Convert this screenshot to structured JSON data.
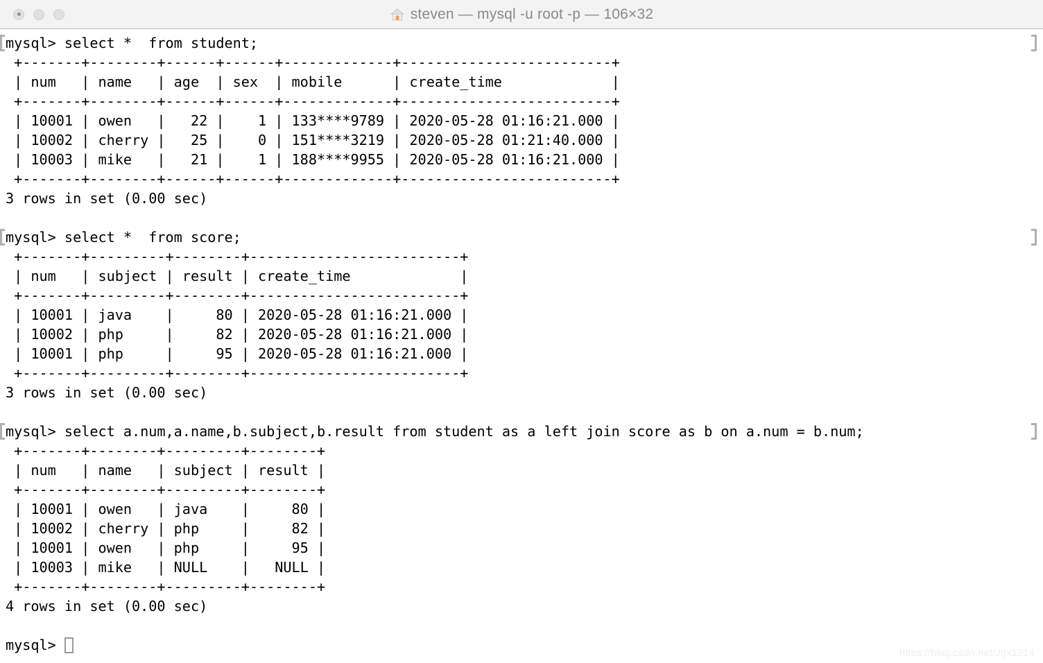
{
  "window": {
    "title": "steven — mysql -u root -p — 106×32",
    "title_icon": "house-icon",
    "traffic_lights": [
      {
        "name": "close-button",
        "label": ""
      },
      {
        "name": "minimize-button",
        "label": ""
      },
      {
        "name": "zoom-button",
        "label": ""
      }
    ],
    "colors": {
      "titlebar_bg": "#f3f3f3",
      "titlebar_border": "#b5b5b5",
      "terminal_bg": "#ffffff",
      "terminal_fg": "#000000",
      "title_fg": "#8a8a8a",
      "mark_color": "#b0b0b0",
      "cursor_border": "#9a9a9a",
      "watermark_fg": "#f1f1f1"
    }
  },
  "terminal": {
    "prompt": "mysql> ",
    "cursor": "block-hollow",
    "lines": [
      {
        "mark": true,
        "text": "mysql> select *  from student;"
      },
      {
        "mark": false,
        "text": " +-------+--------+------+------+-------------+-------------------------+"
      },
      {
        "mark": false,
        "text": " | num   | name   | age  | sex  | mobile      | create_time             |"
      },
      {
        "mark": false,
        "text": " +-------+--------+------+------+-------------+-------------------------+"
      },
      {
        "mark": false,
        "text": " | 10001 | owen   |   22 |    1 | 133****9789 | 2020-05-28 01:16:21.000 |"
      },
      {
        "mark": false,
        "text": " | 10002 | cherry |   25 |    0 | 151****3219 | 2020-05-28 01:21:40.000 |"
      },
      {
        "mark": false,
        "text": " | 10003 | mike   |   21 |    1 | 188****9955 | 2020-05-28 01:16:21.000 |"
      },
      {
        "mark": false,
        "text": " +-------+--------+------+------+-------------+-------------------------+"
      },
      {
        "mark": false,
        "text": "3 rows in set (0.00 sec)"
      },
      {
        "mark": false,
        "text": ""
      },
      {
        "mark": true,
        "text": "mysql> select *  from score;"
      },
      {
        "mark": false,
        "text": " +-------+---------+--------+-------------------------+"
      },
      {
        "mark": false,
        "text": " | num   | subject | result | create_time             |"
      },
      {
        "mark": false,
        "text": " +-------+---------+--------+-------------------------+"
      },
      {
        "mark": false,
        "text": " | 10001 | java    |     80 | 2020-05-28 01:16:21.000 |"
      },
      {
        "mark": false,
        "text": " | 10002 | php     |     82 | 2020-05-28 01:16:21.000 |"
      },
      {
        "mark": false,
        "text": " | 10001 | php     |     95 | 2020-05-28 01:16:21.000 |"
      },
      {
        "mark": false,
        "text": " +-------+---------+--------+-------------------------+"
      },
      {
        "mark": false,
        "text": "3 rows in set (0.00 sec)"
      },
      {
        "mark": false,
        "text": ""
      },
      {
        "mark": true,
        "text": "mysql> select a.num,a.name,b.subject,b.result from student as a left join score as b on a.num = b.num;"
      },
      {
        "mark": false,
        "text": " +-------+--------+---------+--------+"
      },
      {
        "mark": false,
        "text": " | num   | name   | subject | result |"
      },
      {
        "mark": false,
        "text": " +-------+--------+---------+--------+"
      },
      {
        "mark": false,
        "text": " | 10001 | owen   | java    |     80 |"
      },
      {
        "mark": false,
        "text": " | 10002 | cherry | php     |     82 |"
      },
      {
        "mark": false,
        "text": " | 10001 | owen   | php     |     95 |"
      },
      {
        "mark": false,
        "text": " | 10003 | mike   | NULL    |   NULL |"
      },
      {
        "mark": false,
        "text": " +-------+--------+---------+--------+"
      },
      {
        "mark": false,
        "text": "4 rows in set (0.00 sec)"
      },
      {
        "mark": false,
        "text": ""
      }
    ],
    "final_prompt": "mysql> "
  },
  "queries": [
    {
      "command": "select *  from student;",
      "result_table": {
        "columns": [
          "num",
          "name",
          "age",
          "sex",
          "mobile",
          "create_time"
        ],
        "rows": [
          [
            "10001",
            "owen",
            "22",
            "1",
            "133****9789",
            "2020-05-28 01:16:21.000"
          ],
          [
            "10002",
            "cherry",
            "25",
            "0",
            "151****3219",
            "2020-05-28 01:21:40.000"
          ],
          [
            "10003",
            "mike",
            "21",
            "1",
            "188****9955",
            "2020-05-28 01:16:21.000"
          ]
        ]
      },
      "status": "3 rows in set (0.00 sec)"
    },
    {
      "command": "select *  from score;",
      "result_table": {
        "columns": [
          "num",
          "subject",
          "result",
          "create_time"
        ],
        "rows": [
          [
            "10001",
            "java",
            "80",
            "2020-05-28 01:16:21.000"
          ],
          [
            "10002",
            "php",
            "82",
            "2020-05-28 01:16:21.000"
          ],
          [
            "10001",
            "php",
            "95",
            "2020-05-28 01:16:21.000"
          ]
        ]
      },
      "status": "3 rows in set (0.00 sec)"
    },
    {
      "command": "select a.num,a.name,b.subject,b.result from student as a left join score as b on a.num = b.num;",
      "result_table": {
        "columns": [
          "num",
          "name",
          "subject",
          "result"
        ],
        "rows": [
          [
            "10001",
            "owen",
            "java",
            "80"
          ],
          [
            "10002",
            "cherry",
            "php",
            "82"
          ],
          [
            "10001",
            "owen",
            "php",
            "95"
          ],
          [
            "10003",
            "mike",
            "NULL",
            "NULL"
          ]
        ]
      },
      "status": "4 rows in set (0.00 sec)"
    }
  ],
  "watermark": {
    "text": "https://blog.csdn.net/Jgx1214"
  }
}
